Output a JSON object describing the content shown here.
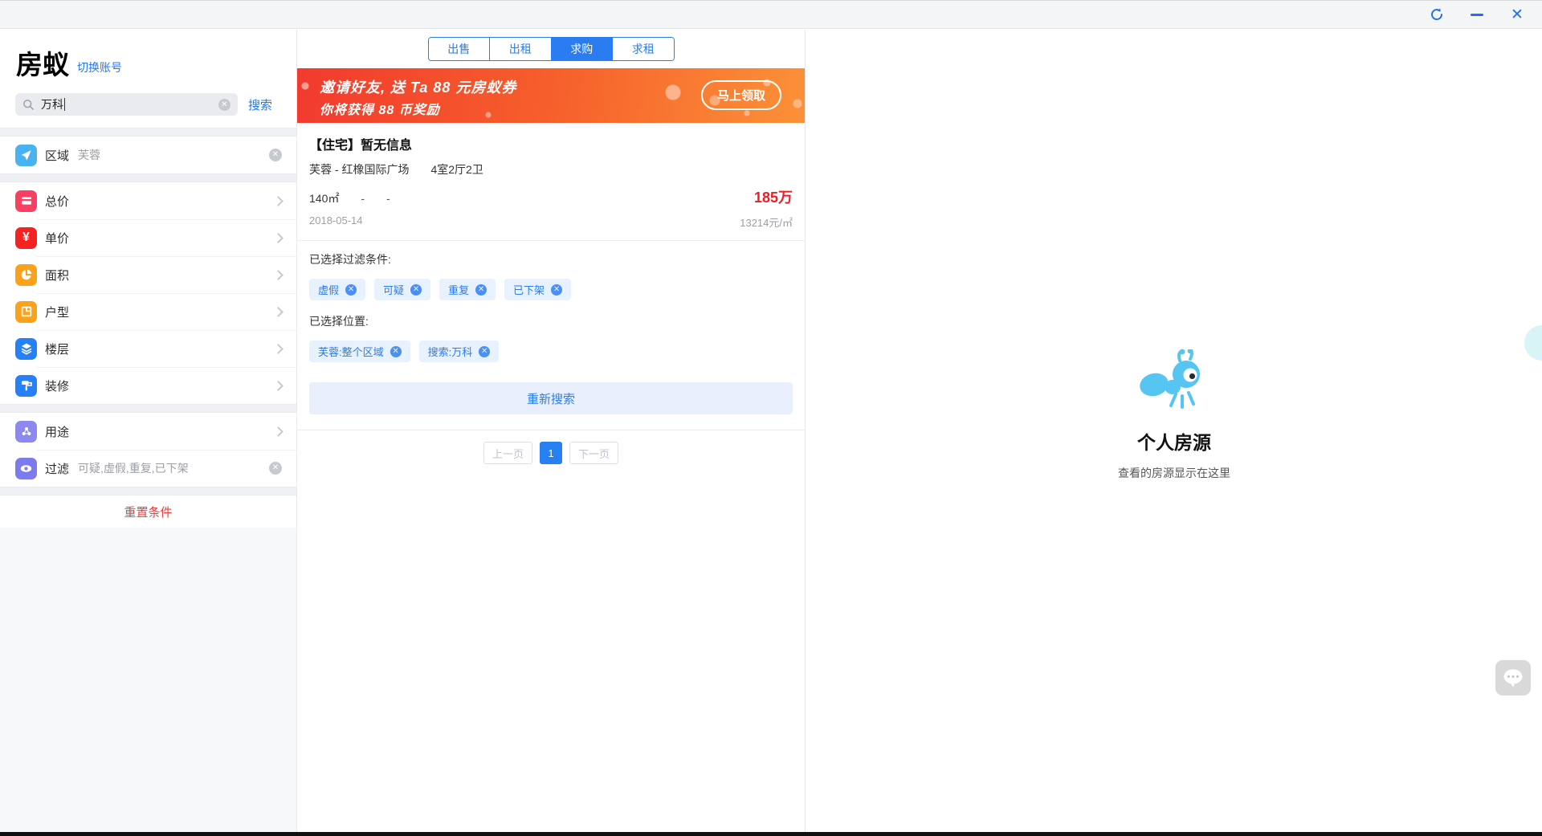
{
  "window": {
    "refresh": "↻",
    "minimize": "—",
    "close": "✕"
  },
  "sidebar": {
    "logo": "房蚁",
    "switch_account": "切换账号",
    "search": {
      "value": "万科",
      "clear": "✕",
      "action": "搜索"
    },
    "region": {
      "label": "区域",
      "value": "芙蓉",
      "clear": "✕"
    },
    "filters": [
      {
        "label": "总价"
      },
      {
        "label": "单价"
      },
      {
        "label": "面积"
      },
      {
        "label": "户型"
      },
      {
        "label": "楼层"
      },
      {
        "label": "装修"
      }
    ],
    "usage": {
      "label": "用途"
    },
    "filter_row": {
      "label": "过滤",
      "value": "可疑,虚假,重复,已下架",
      "clear": "✕"
    },
    "reset": "重置条件",
    "yen_glyph": "¥"
  },
  "listing": {
    "tabs": [
      {
        "label": "出售"
      },
      {
        "label": "出租"
      },
      {
        "label": "求购"
      },
      {
        "label": "求租"
      }
    ],
    "banner": {
      "line1": "邀请好友, 送 Ta 88 元房蚁券",
      "line2": "你将获得 88 币奖励",
      "button": "马上领取"
    },
    "card": {
      "title": "【住宅】暂无信息",
      "location": "芙蓉 - 红橡国际广场",
      "layout": "4室2厅2卫",
      "area": "140㎡",
      "dash1": "-",
      "dash2": "-",
      "price": "185万",
      "date": "2018-05-14",
      "unit_price": "13214元/㎡"
    },
    "filter_section": {
      "title": "已选择过滤条件:",
      "tags": [
        "虚假",
        "可疑",
        "重复",
        "已下架"
      ],
      "remove": "✕"
    },
    "position_section": {
      "title": "已选择位置:",
      "tags": [
        "芙蓉:整个区域",
        "搜索:万科"
      ],
      "remove": "✕"
    },
    "research_button": "重新搜索",
    "pagination": {
      "prev": "上一页",
      "current": "1",
      "next": "下一页"
    }
  },
  "personal_panel": {
    "title": "个人房源",
    "subtitle": "查看的房源显示在这里"
  },
  "colors": {
    "accent_blue": "#2b7cf0",
    "price_red": "#ee1c25",
    "reset_red": "#f03c3c",
    "banner_gradient_from": "#f23a2e",
    "banner_gradient_to": "#fb9138",
    "tag_bg": "#e8f1fe",
    "ant_blue": "#56c5f2"
  }
}
